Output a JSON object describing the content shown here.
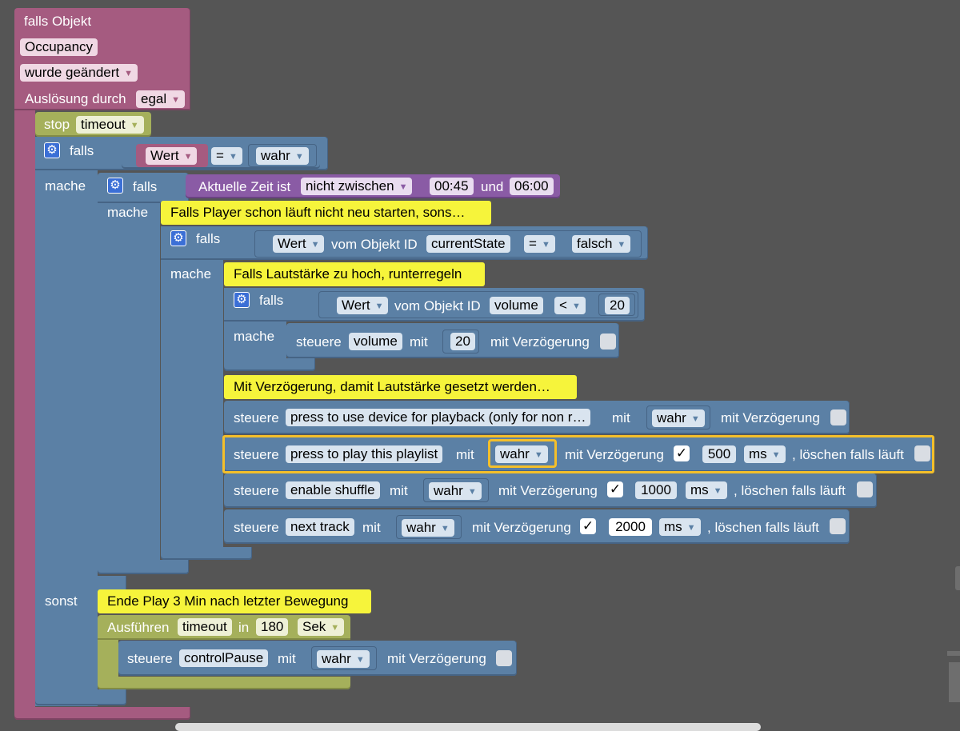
{
  "trigger": {
    "header": "falls Objekt",
    "object": "Occupancy",
    "event": "wurde geändert",
    "by_label": "Auslösung durch",
    "by_value": "egal"
  },
  "stop": {
    "label": "stop",
    "value": "timeout"
  },
  "if1": {
    "falls": "falls",
    "mache": "mache",
    "sonst": "sonst",
    "var": "Wert",
    "op": "=",
    "value": "wahr"
  },
  "if2": {
    "falls": "falls",
    "mache": "mache",
    "time_label": "Aktuelle Zeit ist",
    "time_mode": "nicht zwischen",
    "time_from": "00:45",
    "and_label": "und",
    "time_to": "06:00"
  },
  "comment1": "Falls Player schon läuft nicht neu starten, sons…",
  "if3": {
    "falls": "falls",
    "mache": "mache",
    "var": "Wert",
    "from_label": "vom Objekt ID",
    "obj": "currentState",
    "op": "=",
    "value": "falsch"
  },
  "comment2": "Falls Lautstärke zu hoch, runterregeln",
  "if4": {
    "falls": "falls",
    "mache": "mache",
    "var": "Wert",
    "from_label": "vom Objekt ID",
    "obj": "volume",
    "op": "<",
    "value": "20"
  },
  "ctrl_volume": {
    "label": "steuere",
    "obj": "volume",
    "with": "mit",
    "value": "20",
    "delay_label": "mit Verzögerung"
  },
  "comment3": "Mit Verzögerung, damit Lautstärke gesetzt werden…",
  "ctrl_device": {
    "label": "steuere",
    "obj": "press to use device for playback (only for non r…",
    "with": "mit",
    "value": "wahr",
    "delay_label": "mit Verzögerung"
  },
  "ctrl_playlist": {
    "label": "steuere",
    "obj": "press to play this playlist",
    "with": "mit",
    "value": "wahr",
    "delay_label": "mit Verzögerung",
    "check": "✓",
    "delay": "500",
    "unit": "ms",
    "clear_label": ", löschen falls läuft"
  },
  "ctrl_shuffle": {
    "label": "steuere",
    "obj": "enable shuffle",
    "with": "mit",
    "value": "wahr",
    "delay_label": "mit Verzögerung",
    "check": "✓",
    "delay": "1000",
    "unit": "ms",
    "clear_label": ", löschen falls läuft"
  },
  "ctrl_next": {
    "label": "steuere",
    "obj": "next track",
    "with": "mit",
    "value": "wahr",
    "delay_label": "mit Verzögerung",
    "check": "✓",
    "delay": "2000",
    "unit": "ms",
    "clear_label": ", löschen falls läuft"
  },
  "comment4": "Ende Play 3 Min nach letzter Bewegung",
  "timeout": {
    "label": "Ausführen",
    "name": "timeout",
    "in_label": "in",
    "value": "180",
    "unit": "Sek"
  },
  "ctrl_pause": {
    "label": "steuere",
    "obj": "controlPause",
    "with": "mit",
    "value": "wahr",
    "delay_label": "mit Verzögerung"
  },
  "colors": {
    "background": "#555555",
    "trigger": "#a55b80",
    "logic": "#5b80a5",
    "time": "#8a5ba5",
    "timer": "#a5b05b",
    "comment": "#f6f43b",
    "selection": "#f4bf2a"
  },
  "icons": {
    "gear": "gear-icon",
    "dropdown": "chevron-down-icon",
    "trash": "trash-icon"
  }
}
